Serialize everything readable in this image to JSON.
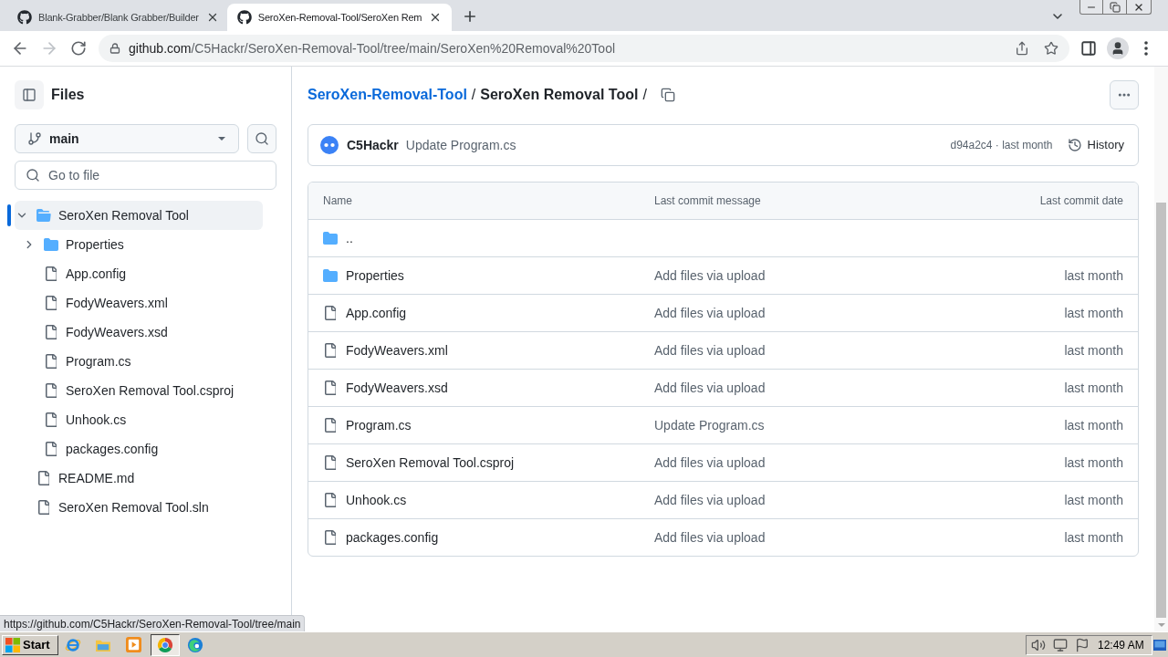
{
  "browser": {
    "tabs": [
      {
        "title": "Blank-Grabber/Blank Grabber/Builder",
        "selected": false
      },
      {
        "title": "SeroXen-Removal-Tool/SeroXen Rem",
        "selected": true
      }
    ],
    "url": {
      "host": "github.com",
      "path": "/C5Hackr/SeroXen-Removal-Tool/tree/main/SeroXen%20Removal%20Tool"
    }
  },
  "sidebar": {
    "title": "Files",
    "branch": "main",
    "file_search": {
      "placeholder": "Go to file"
    },
    "tree": [
      {
        "name": "SeroXen Removal Tool",
        "kind": "folder",
        "expanded": true,
        "selected": true,
        "children": [
          {
            "name": "Properties",
            "kind": "folder",
            "expanded": false,
            "selected": false
          },
          {
            "name": "App.config",
            "kind": "file",
            "selected": false
          },
          {
            "name": "FodyWeavers.xml",
            "kind": "file",
            "selected": false
          },
          {
            "name": "FodyWeavers.xsd",
            "kind": "file",
            "selected": false
          },
          {
            "name": "Program.cs",
            "kind": "file",
            "selected": false
          },
          {
            "name": "SeroXen Removal Tool.csproj",
            "kind": "file",
            "selected": false
          },
          {
            "name": "Unhook.cs",
            "kind": "file",
            "selected": false
          },
          {
            "name": "packages.config",
            "kind": "file",
            "selected": false
          }
        ]
      },
      {
        "name": "README.md",
        "kind": "file",
        "selected": false
      },
      {
        "name": "SeroXen Removal Tool.sln",
        "kind": "file",
        "selected": false
      }
    ]
  },
  "breadcrumb": {
    "items": [
      {
        "label": "SeroXen-Removal-Tool",
        "kind": "link",
        "separator": "/"
      },
      {
        "label": "SeroXen Removal Tool",
        "kind": "current",
        "separator": "/"
      }
    ]
  },
  "latest_commit": {
    "author": "C5Hackr",
    "message": "Update Program.cs",
    "meta": "d94a2c4 · last month",
    "history": "History"
  },
  "table": {
    "columns": [
      "Name",
      "Last commit message",
      "Last commit date"
    ],
    "rows": [
      {
        "name": "..",
        "kind": "parent"
      },
      {
        "name": "Properties",
        "kind": "folder",
        "message": "Add files via upload",
        "date": "last month"
      },
      {
        "name": "App.config",
        "kind": "file",
        "message": "Add files via upload",
        "date": "last month"
      },
      {
        "name": "FodyWeavers.xml",
        "kind": "file",
        "message": "Add files via upload",
        "date": "last month"
      },
      {
        "name": "FodyWeavers.xsd",
        "kind": "file",
        "message": "Add files via upload",
        "date": "last month"
      },
      {
        "name": "Program.cs",
        "kind": "file",
        "message": "Update Program.cs",
        "date": "last month"
      },
      {
        "name": "SeroXen Removal Tool.csproj",
        "kind": "file",
        "message": "Add files via upload",
        "date": "last month"
      },
      {
        "name": "Unhook.cs",
        "kind": "file",
        "message": "Add files via upload",
        "date": "last month"
      },
      {
        "name": "packages.config",
        "kind": "file",
        "message": "Add files via upload",
        "date": "last month"
      }
    ]
  },
  "status_bubble": "https://github.com/C5Hackr/SeroXen-Removal-Tool/tree/main",
  "taskbar": {
    "start": "Start",
    "clock": "12:49 AM"
  }
}
